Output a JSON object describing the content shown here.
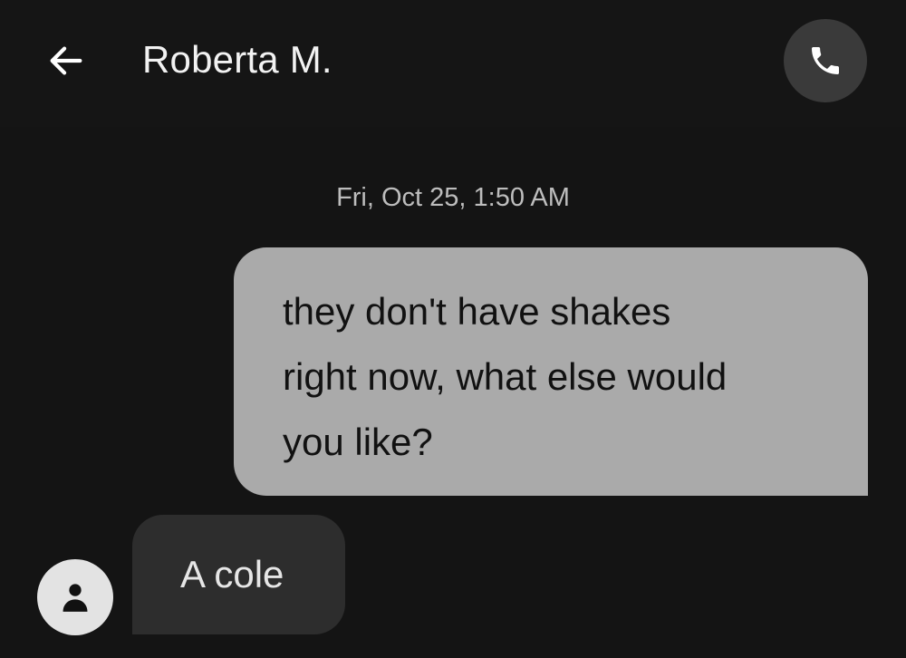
{
  "header": {
    "back_icon": "arrow-left-icon",
    "contact_name": "Roberta M.",
    "call_icon": "phone-icon"
  },
  "conversation": {
    "timestamp": "Fri, Oct 25, 1:50 AM",
    "messages": [
      {
        "direction": "outgoing",
        "text": "they don't have shakes\nright now, what else would\nyou like?"
      },
      {
        "direction": "incoming",
        "sender_avatar_icon": "person-icon",
        "text": "A cole"
      }
    ]
  },
  "colors": {
    "background": "#141414",
    "outgoing_bubble": "#aaaaaa",
    "incoming_bubble": "#2d2d2d",
    "call_button": "#3a3a3a"
  }
}
